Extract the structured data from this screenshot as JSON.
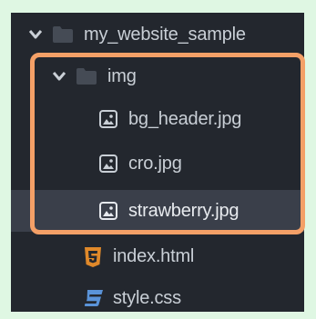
{
  "tree": {
    "root": {
      "name": "my_website_sample",
      "expanded": true
    },
    "img_folder": {
      "name": "img",
      "expanded": true
    },
    "img_files": [
      {
        "name": "bg_header.jpg",
        "selected": false
      },
      {
        "name": "cro.jpg",
        "selected": false
      },
      {
        "name": "strawberry.jpg",
        "selected": true
      }
    ],
    "root_files": [
      {
        "name": "index.html",
        "icon": "html5-icon"
      },
      {
        "name": "style.css",
        "icon": "css3-icon"
      }
    ]
  },
  "colors": {
    "background": "#dff7e3",
    "panel": "#23272e",
    "selected_row": "#3a3f4a",
    "highlight_border": "#f4a067",
    "html_icon": "#e0892a",
    "css_icon": "#5a93d8"
  }
}
